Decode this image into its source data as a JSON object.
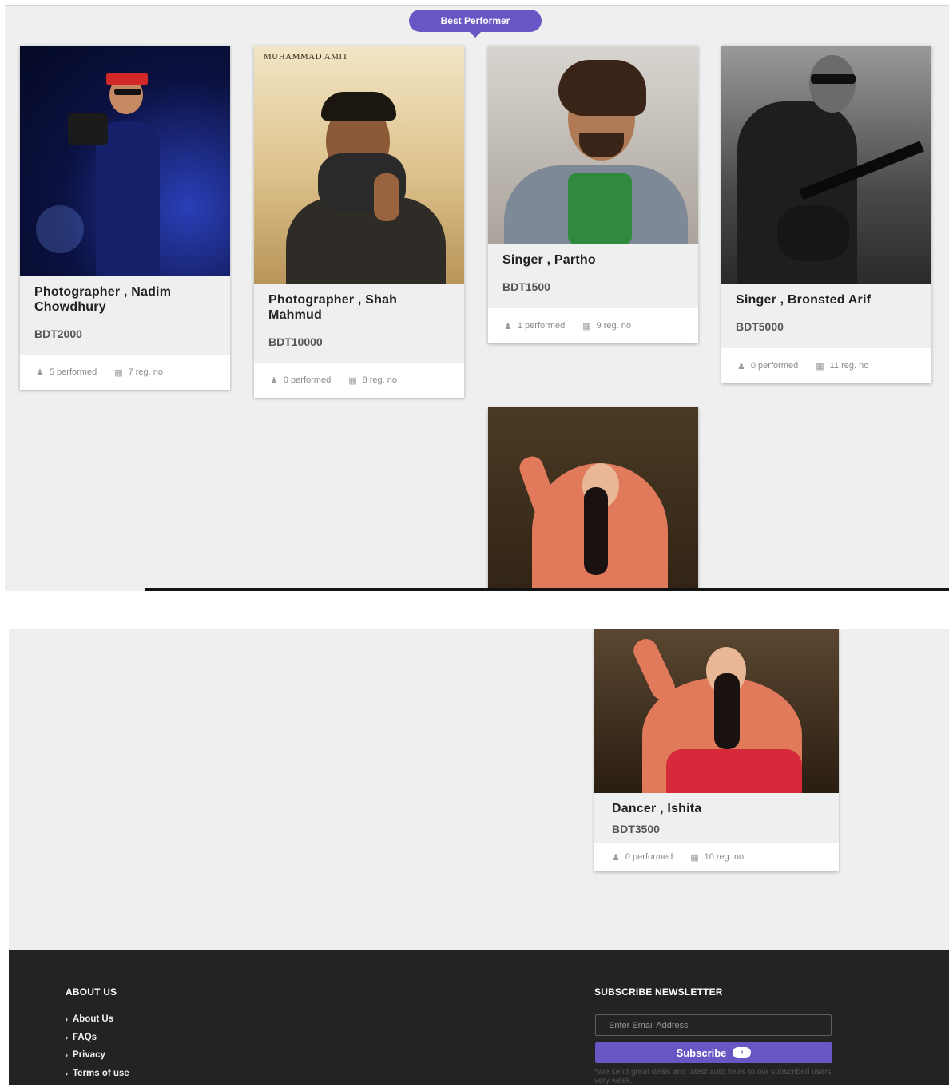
{
  "section": {
    "badge": "Best Performer"
  },
  "performers": [
    {
      "title": "Photographer , Nadim Chowdhury",
      "price": "BDT2000",
      "performed": "5 performed",
      "reg": "7 reg. no"
    },
    {
      "title": "Photographer , Shah Mahmud",
      "price": "BDT10000",
      "performed": "0 performed",
      "reg": "8 reg. no",
      "watermark": "MUHAMMAD AMIT"
    },
    {
      "title": "Singer , Partho",
      "price": "BDT1500",
      "performed": "1 performed",
      "reg": "9 reg. no"
    },
    {
      "title": "Singer , Bronsted Arif",
      "price": "BDT5000",
      "performed": "0 performed",
      "reg": "11 reg. no"
    },
    {
      "title": "Dancer , Ishita",
      "price": "BDT3500",
      "performed": "0 performed",
      "reg": "10 reg. no"
    }
  ],
  "icons": {
    "performed": "user-icon",
    "reg": "calendar-icon",
    "link": "chevron-right-icon",
    "subscribe": "arrow-right-icon"
  },
  "footer": {
    "about_heading": "ABOUT US",
    "links": [
      "About Us",
      "FAQs",
      "Privacy",
      "Terms of use"
    ],
    "newsletter_heading": "SUBSCRIBE NEWSLETTER",
    "email_placeholder": "Enter Email Address",
    "subscribe_label": "Subscribe",
    "note": "*We send great deals and latest auto news to our subscribed users very week."
  },
  "colors": {
    "accent": "#6a55c4",
    "footer_bg": "#232323",
    "page_bg": "#efefef"
  }
}
